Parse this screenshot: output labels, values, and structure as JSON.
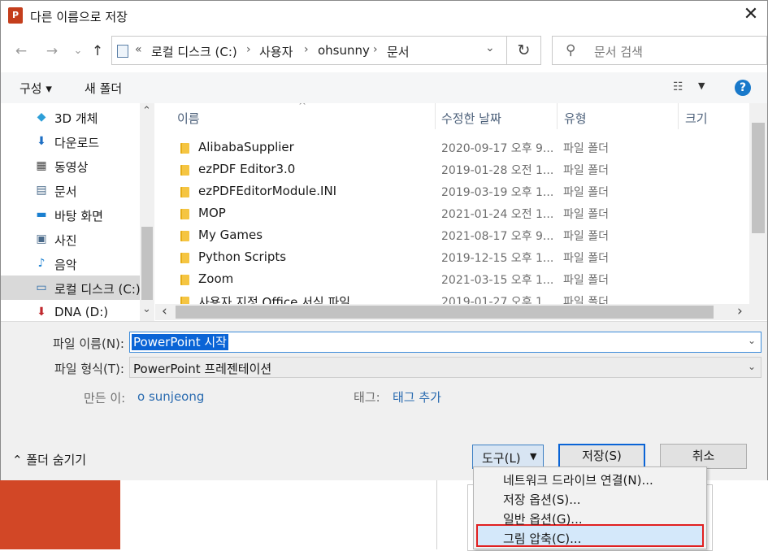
{
  "window": {
    "title": "다른 이름으로 저장",
    "app_icon": "P",
    "close": "✕"
  },
  "nav": {
    "back": "←",
    "forward": "→",
    "recent": "⌄",
    "up": "↑"
  },
  "address": {
    "prefix": "«",
    "segments": [
      "로컬 디스크 (C:)",
      "사용자",
      "ohsunny",
      "문서"
    ],
    "sep": "›",
    "dropdown": "⌄",
    "refresh": "↻"
  },
  "search": {
    "placeholder": "문서 검색",
    "icon": "⚲"
  },
  "toolbar": {
    "organize": "구성 ▾",
    "new_folder": "새 폴더",
    "view_icon": "☷",
    "view_dd": "▼",
    "help": "?"
  },
  "sidebar": {
    "items": [
      {
        "label": "3D 개체",
        "icon": "cube-icon",
        "glyph": "◆",
        "color": "#2e9fd8"
      },
      {
        "label": "다운로드",
        "icon": "download-icon",
        "glyph": "⬇",
        "color": "#1e6fc4"
      },
      {
        "label": "동영상",
        "icon": "film-icon",
        "glyph": "▦",
        "color": "#444444"
      },
      {
        "label": "문서",
        "icon": "document-icon",
        "glyph": "▤",
        "color": "#4a6a8a"
      },
      {
        "label": "바탕 화면",
        "icon": "desktop-icon",
        "glyph": "▬",
        "color": "#1a7fd0"
      },
      {
        "label": "사진",
        "icon": "picture-icon",
        "glyph": "▣",
        "color": "#4a6a8a"
      },
      {
        "label": "음악",
        "icon": "music-icon",
        "glyph": "♪",
        "color": "#1a7fd0"
      },
      {
        "label": "로컬 디스크 (C:)",
        "icon": "drive-c-icon",
        "glyph": "▭",
        "color": "#2a6aa8"
      },
      {
        "label": "DNA (D:)",
        "icon": "drive-d-icon",
        "glyph": "⬇",
        "color": "#c0282d"
      }
    ],
    "selected_index": 7,
    "scroll_up": "⌃",
    "scroll_down": "⌄"
  },
  "columns": {
    "name": "이름",
    "date": "수정한 날짜",
    "type": "유형",
    "size": "크기",
    "sort": "^"
  },
  "files": [
    {
      "name": "AlibabaSupplier",
      "date": "2020-09-17 오후 9...",
      "type": "파일 폴더"
    },
    {
      "name": "ezPDF Editor3.0",
      "date": "2019-01-28 오전 1...",
      "type": "파일 폴더"
    },
    {
      "name": "ezPDFEditorModule.INI",
      "date": "2019-03-19 오후 1...",
      "type": "파일 폴더"
    },
    {
      "name": "MOP",
      "date": "2021-01-24 오전 1...",
      "type": "파일 폴더"
    },
    {
      "name": "My Games",
      "date": "2021-08-17 오후 9...",
      "type": "파일 폴더"
    },
    {
      "name": "Python Scripts",
      "date": "2019-12-15 오후 1...",
      "type": "파일 폴더"
    },
    {
      "name": "Zoom",
      "date": "2021-03-15 오후 1...",
      "type": "파일 폴더"
    },
    {
      "name": "사용자 지정 Office 서식 파일",
      "date": "2019-01-27 오후 1...",
      "type": "파일 폴더"
    }
  ],
  "scroll": {
    "left": "‹",
    "right": "›"
  },
  "form": {
    "filename_label": "파일 이름(N):",
    "filename_value": "PowerPoint 시작",
    "filetype_label": "파일 형식(T):",
    "filetype_value": "PowerPoint 프레젠테이션",
    "dd": "⌄",
    "author_label": "만든 이:",
    "author_value": "o sunjeong",
    "tags_label": "태그:",
    "tags_value": "태그 추가"
  },
  "footer": {
    "hide_folders": "⌃  폴더 숨기기",
    "tools": "도구(L)",
    "tools_dd": "▼",
    "save": "저장(S)",
    "cancel": "취소"
  },
  "tools_menu": {
    "items": [
      "네트워크 드라이브 연결(N)...",
      "저장 옵션(S)...",
      "일반 옵션(G)...",
      "그림 압축(C)..."
    ],
    "highlighted_index": 3
  }
}
